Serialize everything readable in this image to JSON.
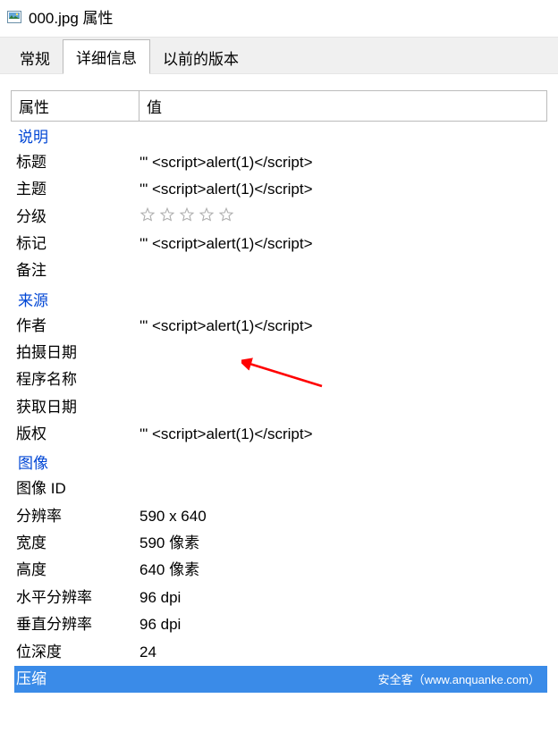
{
  "titlebar": {
    "filename": "000.jpg",
    "suffix": "属性"
  },
  "tabs": {
    "general": "常规",
    "details": "详细信息",
    "previous": "以前的版本",
    "active": "details"
  },
  "header": {
    "property": "属性",
    "value": "值"
  },
  "sections": {
    "description": {
      "label": "说明"
    },
    "origin": {
      "label": "来源"
    },
    "image": {
      "label": "图像"
    }
  },
  "rows": {
    "title": {
      "label": "标题",
      "value": "'\" <script>alert(1)</script>"
    },
    "subject": {
      "label": "主题",
      "value": "'\" <script>alert(1)</script>"
    },
    "rating": {
      "label": "分级",
      "value": 0
    },
    "tags": {
      "label": "标记",
      "value": "'\" <script>alert(1)</script>"
    },
    "comments": {
      "label": "备注",
      "value": ""
    },
    "authors": {
      "label": "作者",
      "value": "'\" <script>alert(1)</script>"
    },
    "date_taken": {
      "label": "拍摄日期",
      "value": ""
    },
    "program_name": {
      "label": "程序名称",
      "value": ""
    },
    "acquired": {
      "label": "获取日期",
      "value": ""
    },
    "copyright": {
      "label": "版权",
      "value": "'\" <script>alert(1)</script>"
    },
    "image_id": {
      "label": "图像 ID",
      "value": ""
    },
    "dimensions": {
      "label": "分辨率",
      "value": "590 x 640"
    },
    "width": {
      "label": "宽度",
      "value": "590 像素"
    },
    "height": {
      "label": "高度",
      "value": "640 像素"
    },
    "hres": {
      "label": "水平分辨率",
      "value": "96 dpi"
    },
    "vres": {
      "label": "垂直分辨率",
      "value": "96 dpi"
    },
    "bitdepth": {
      "label": "位深度",
      "value": "24"
    },
    "compression": {
      "label": "压缩",
      "value": ""
    }
  },
  "footer": {
    "text": "安全客（www.anquanke.com）"
  }
}
